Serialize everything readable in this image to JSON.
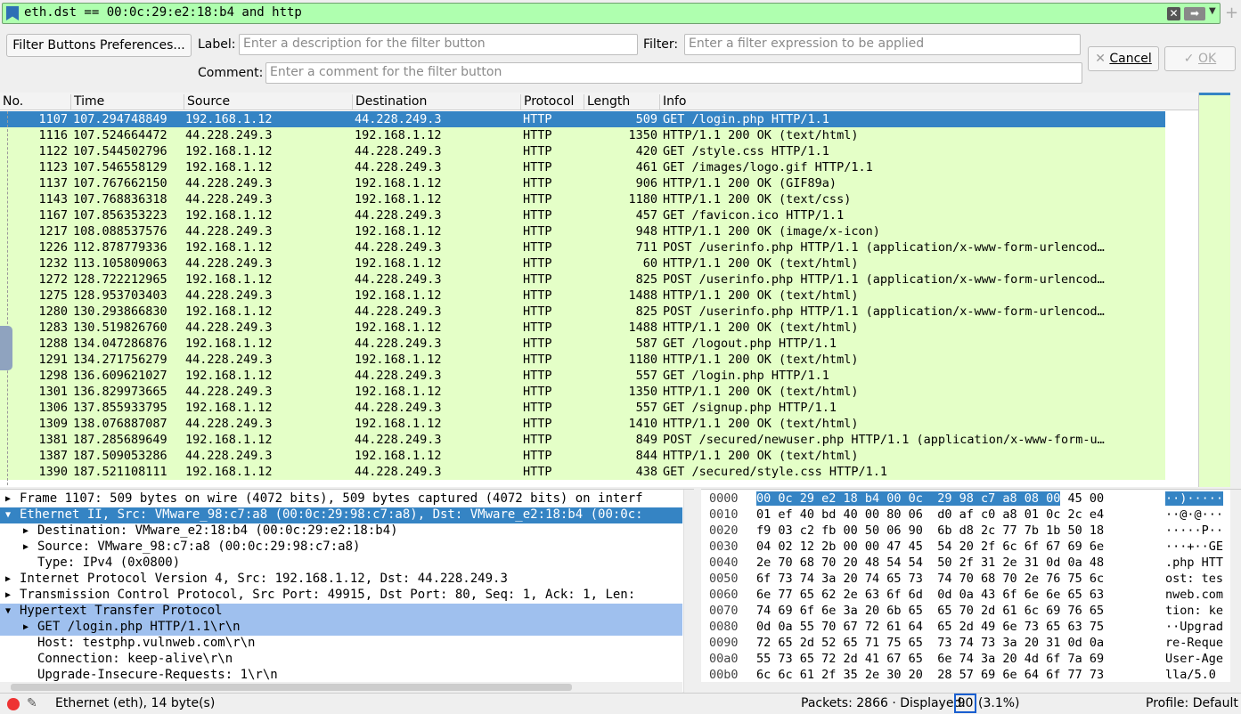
{
  "filter": {
    "value": "eth.dst == 00:0c:29:e2:18:b4 and http"
  },
  "prefs": {
    "button_label": "Filter Buttons Preferences...",
    "label_label": "Label:",
    "label_placeholder": "Enter a description for the filter button",
    "filter_label": "Filter:",
    "filter_placeholder": "Enter a filter expression to be applied",
    "comment_label": "Comment:",
    "comment_placeholder": "Enter a comment for the filter button",
    "cancel_label": "Cancel",
    "ok_label": "OK"
  },
  "packet_list": {
    "columns": [
      "No.",
      "Time",
      "Source",
      "Destination",
      "Protocol",
      "Length",
      "Info"
    ],
    "rows": [
      {
        "no": "1107",
        "time": "107.294748849",
        "src": "192.168.1.12",
        "dst": "44.228.249.3",
        "proto": "HTTP",
        "len": "509",
        "info": "GET /login.php HTTP/1.1",
        "selected": true
      },
      {
        "no": "1116",
        "time": "107.524664472",
        "src": "44.228.249.3",
        "dst": "192.168.1.12",
        "proto": "HTTP",
        "len": "1350",
        "info": "HTTP/1.1 200 OK  (text/html)"
      },
      {
        "no": "1122",
        "time": "107.544502796",
        "src": "192.168.1.12",
        "dst": "44.228.249.3",
        "proto": "HTTP",
        "len": "420",
        "info": "GET /style.css HTTP/1.1"
      },
      {
        "no": "1123",
        "time": "107.546558129",
        "src": "192.168.1.12",
        "dst": "44.228.249.3",
        "proto": "HTTP",
        "len": "461",
        "info": "GET /images/logo.gif HTTP/1.1"
      },
      {
        "no": "1137",
        "time": "107.767662150",
        "src": "44.228.249.3",
        "dst": "192.168.1.12",
        "proto": "HTTP",
        "len": "906",
        "info": "HTTP/1.1 200 OK  (GIF89a)"
      },
      {
        "no": "1143",
        "time": "107.768836318",
        "src": "44.228.249.3",
        "dst": "192.168.1.12",
        "proto": "HTTP",
        "len": "1180",
        "info": "HTTP/1.1 200 OK  (text/css)"
      },
      {
        "no": "1167",
        "time": "107.856353223",
        "src": "192.168.1.12",
        "dst": "44.228.249.3",
        "proto": "HTTP",
        "len": "457",
        "info": "GET /favicon.ico HTTP/1.1"
      },
      {
        "no": "1217",
        "time": "108.088537576",
        "src": "44.228.249.3",
        "dst": "192.168.1.12",
        "proto": "HTTP",
        "len": "948",
        "info": "HTTP/1.1 200 OK  (image/x-icon)"
      },
      {
        "no": "1226",
        "time": "112.878779336",
        "src": "192.168.1.12",
        "dst": "44.228.249.3",
        "proto": "HTTP",
        "len": "711",
        "info": "POST /userinfo.php HTTP/1.1  (application/x-www-form-urlencod…"
      },
      {
        "no": "1232",
        "time": "113.105809063",
        "src": "44.228.249.3",
        "dst": "192.168.1.12",
        "proto": "HTTP",
        "len": "60",
        "info": "HTTP/1.1 200 OK  (text/html)"
      },
      {
        "no": "1272",
        "time": "128.722212965",
        "src": "192.168.1.12",
        "dst": "44.228.249.3",
        "proto": "HTTP",
        "len": "825",
        "info": "POST /userinfo.php HTTP/1.1  (application/x-www-form-urlencod…"
      },
      {
        "no": "1275",
        "time": "128.953703403",
        "src": "44.228.249.3",
        "dst": "192.168.1.12",
        "proto": "HTTP",
        "len": "1488",
        "info": "HTTP/1.1 200 OK  (text/html)"
      },
      {
        "no": "1280",
        "time": "130.293866830",
        "src": "192.168.1.12",
        "dst": "44.228.249.3",
        "proto": "HTTP",
        "len": "825",
        "info": "POST /userinfo.php HTTP/1.1  (application/x-www-form-urlencod…"
      },
      {
        "no": "1283",
        "time": "130.519826760",
        "src": "44.228.249.3",
        "dst": "192.168.1.12",
        "proto": "HTTP",
        "len": "1488",
        "info": "HTTP/1.1 200 OK  (text/html)"
      },
      {
        "no": "1288",
        "time": "134.047286876",
        "src": "192.168.1.12",
        "dst": "44.228.249.3",
        "proto": "HTTP",
        "len": "587",
        "info": "GET /logout.php HTTP/1.1"
      },
      {
        "no": "1291",
        "time": "134.271756279",
        "src": "44.228.249.3",
        "dst": "192.168.1.12",
        "proto": "HTTP",
        "len": "1180",
        "info": "HTTP/1.1 200 OK  (text/html)"
      },
      {
        "no": "1298",
        "time": "136.609621027",
        "src": "192.168.1.12",
        "dst": "44.228.249.3",
        "proto": "HTTP",
        "len": "557",
        "info": "GET /login.php HTTP/1.1"
      },
      {
        "no": "1301",
        "time": "136.829973665",
        "src": "44.228.249.3",
        "dst": "192.168.1.12",
        "proto": "HTTP",
        "len": "1350",
        "info": "HTTP/1.1 200 OK  (text/html)"
      },
      {
        "no": "1306",
        "time": "137.855933795",
        "src": "192.168.1.12",
        "dst": "44.228.249.3",
        "proto": "HTTP",
        "len": "557",
        "info": "GET /signup.php HTTP/1.1"
      },
      {
        "no": "1309",
        "time": "138.076887087",
        "src": "44.228.249.3",
        "dst": "192.168.1.12",
        "proto": "HTTP",
        "len": "1410",
        "info": "HTTP/1.1 200 OK  (text/html)"
      },
      {
        "no": "1381",
        "time": "187.285689649",
        "src": "192.168.1.12",
        "dst": "44.228.249.3",
        "proto": "HTTP",
        "len": "849",
        "info": "POST /secured/newuser.php HTTP/1.1  (application/x-www-form-u…"
      },
      {
        "no": "1387",
        "time": "187.509053286",
        "src": "44.228.249.3",
        "dst": "192.168.1.12",
        "proto": "HTTP",
        "len": "844",
        "info": "HTTP/1.1 200 OK  (text/html)"
      },
      {
        "no": "1390",
        "time": "187.521108111",
        "src": "192.168.1.12",
        "dst": "44.228.249.3",
        "proto": "HTTP",
        "len": "438",
        "info": "GET /secured/style.css HTTP/1.1"
      }
    ]
  },
  "details": {
    "rows": [
      {
        "text": "Frame 1107: 509 bytes on wire (4072 bits), 509 bytes captured (4072 bits) on interf",
        "indent": 0,
        "arrow": "right",
        "state": ""
      },
      {
        "text": "Ethernet II, Src: VMware_98:c7:a8 (00:0c:29:98:c7:a8), Dst: VMware_e2:18:b4 (00:0c:",
        "indent": 0,
        "arrow": "down",
        "state": "sel"
      },
      {
        "text": "Destination: VMware_e2:18:b4 (00:0c:29:e2:18:b4)",
        "indent": 1,
        "arrow": "right",
        "state": ""
      },
      {
        "text": "Source: VMware_98:c7:a8 (00:0c:29:98:c7:a8)",
        "indent": 1,
        "arrow": "right",
        "state": ""
      },
      {
        "text": "Type: IPv4 (0x0800)",
        "indent": 1,
        "arrow": "",
        "state": ""
      },
      {
        "text": "Internet Protocol Version 4, Src: 192.168.1.12, Dst: 44.228.249.3",
        "indent": 0,
        "arrow": "right",
        "state": ""
      },
      {
        "text": "Transmission Control Protocol, Src Port: 49915, Dst Port: 80, Seq: 1, Ack: 1, Len:",
        "indent": 0,
        "arrow": "right",
        "state": ""
      },
      {
        "text": "Hypertext Transfer Protocol",
        "indent": 0,
        "arrow": "down",
        "state": "hl"
      },
      {
        "text": "GET /login.php HTTP/1.1\\r\\n",
        "indent": 1,
        "arrow": "right",
        "state": "hl"
      },
      {
        "text": "Host: testphp.vulnweb.com\\r\\n",
        "indent": 1,
        "arrow": "",
        "state": ""
      },
      {
        "text": "Connection: keep-alive\\r\\n",
        "indent": 1,
        "arrow": "",
        "state": ""
      },
      {
        "text": "Upgrade-Insecure-Requests: 1\\r\\n",
        "indent": 1,
        "arrow": "",
        "state": ""
      }
    ]
  },
  "hex": {
    "rows": [
      {
        "off": "0000",
        "sel": "00 0c 29 e2 18 b4 00 0c  29 98 c7 a8 08 00",
        "rest": " 45 00",
        "ascii_sel": "··)·····",
        "ascii": ""
      },
      {
        "off": "0010",
        "sel": "",
        "rest": "01 ef 40 bd 40 00 80 06  d0 af c0 a8 01 0c 2c e4",
        "ascii_sel": "",
        "ascii": "··@·@···"
      },
      {
        "off": "0020",
        "sel": "",
        "rest": "f9 03 c2 fb 00 50 06 90  6b d8 2c 77 7b 1b 50 18",
        "ascii_sel": "",
        "ascii": "·····P··"
      },
      {
        "off": "0030",
        "sel": "",
        "rest": "04 02 12 2b 00 00 47 45  54 20 2f 6c 6f 67 69 6e",
        "ascii_sel": "",
        "ascii": "···+··GE"
      },
      {
        "off": "0040",
        "sel": "",
        "rest": "2e 70 68 70 20 48 54 54  50 2f 31 2e 31 0d 0a 48",
        "ascii_sel": "",
        "ascii": ".php HTT"
      },
      {
        "off": "0050",
        "sel": "",
        "rest": "6f 73 74 3a 20 74 65 73  74 70 68 70 2e 76 75 6c",
        "ascii_sel": "",
        "ascii": "ost: tes"
      },
      {
        "off": "0060",
        "sel": "",
        "rest": "6e 77 65 62 2e 63 6f 6d  0d 0a 43 6f 6e 6e 65 63",
        "ascii_sel": "",
        "ascii": "nweb.com"
      },
      {
        "off": "0070",
        "sel": "",
        "rest": "74 69 6f 6e 3a 20 6b 65  65 70 2d 61 6c 69 76 65",
        "ascii_sel": "",
        "ascii": "tion: ke"
      },
      {
        "off": "0080",
        "sel": "",
        "rest": "0d 0a 55 70 67 72 61 64  65 2d 49 6e 73 65 63 75",
        "ascii_sel": "",
        "ascii": "··Upgrad"
      },
      {
        "off": "0090",
        "sel": "",
        "rest": "72 65 2d 52 65 71 75 65  73 74 73 3a 20 31 0d 0a",
        "ascii_sel": "",
        "ascii": "re-Reque"
      },
      {
        "off": "00a0",
        "sel": "",
        "rest": "55 73 65 72 2d 41 67 65  6e 74 3a 20 4d 6f 7a 69",
        "ascii_sel": "",
        "ascii": "User-Age"
      },
      {
        "off": "00b0",
        "sel": "",
        "rest": "6c 6c 61 2f 35 2e 30 20  28 57 69 6e 64 6f 77 73",
        "ascii_sel": "",
        "ascii": "lla/5.0 "
      }
    ]
  },
  "status": {
    "field_info": "Ethernet (eth), 14 byte(s)",
    "packets_label": "Packets: 2866 · Displayed:",
    "displayed": "90",
    "percent": "(3.1%)",
    "profile": "Profile: Default"
  },
  "colors": {
    "selected": "#3584c4",
    "http_row": "#e4ffc7",
    "filter_valid": "#afffaf"
  }
}
